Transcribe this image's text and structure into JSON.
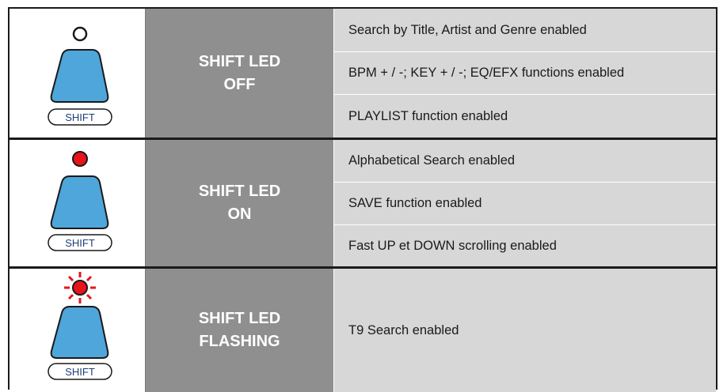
{
  "rows": [
    {
      "state": "SHIFT LED\nOFF",
      "button_label": "SHIFT",
      "led": "off",
      "functions": [
        "Search by Title, Artist and Genre enabled",
        "BPM + / -; KEY + / -; EQ/EFX functions enabled",
        "PLAYLIST function enabled"
      ]
    },
    {
      "state": "SHIFT LED\nON",
      "button_label": "SHIFT",
      "led": "on",
      "functions": [
        "Alphabetical Search enabled",
        "SAVE function enabled",
        "Fast UP et DOWN scrolling enabled"
      ]
    },
    {
      "state": "SHIFT LED\nFLASHING",
      "button_label": "SHIFT",
      "led": "flashing",
      "functions": [
        "T9 Search enabled"
      ]
    }
  ],
  "colors": {
    "button_fill": "#4ea6da",
    "led_red": "#e8141b",
    "state_bg": "#8f8f8f",
    "function_bg": "#d7d7d7"
  }
}
